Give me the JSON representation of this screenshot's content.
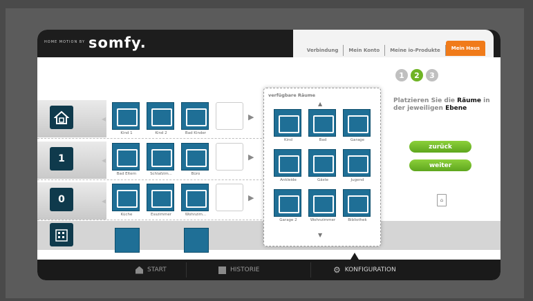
{
  "brand": {
    "tagline": "HOME MOTION BY",
    "logo": "somfy."
  },
  "tabs": [
    {
      "label": "Verbindung",
      "active": false
    },
    {
      "label": "Mein Konto",
      "active": false
    },
    {
      "label": "Meine io-Produkte",
      "active": false
    },
    {
      "label": "Mein Haus",
      "active": true
    }
  ],
  "levels": [
    {
      "name": "top-level",
      "icon": "house-roof-icon",
      "number": "",
      "rooms": [
        {
          "label": "Kind 1"
        },
        {
          "label": "Kind 2"
        },
        {
          "label": "Bad Kinder"
        }
      ]
    },
    {
      "name": "level-1",
      "icon": "house-level-1-icon",
      "number": "1",
      "rooms": [
        {
          "label": "Bad Eltern"
        },
        {
          "label": "Schlafzim..."
        },
        {
          "label": "Büro"
        }
      ]
    },
    {
      "name": "level-0",
      "icon": "house-level-0-icon",
      "number": "0",
      "rooms": [
        {
          "label": "Küche"
        },
        {
          "label": "Esszimmer"
        },
        {
          "label": "Wohnzim..."
        }
      ]
    }
  ],
  "available_rooms": {
    "title": "verfügbare Räume",
    "rooms": [
      {
        "label": "Kind"
      },
      {
        "label": "Bad"
      },
      {
        "label": "Garage"
      },
      {
        "label": "Ankleide"
      },
      {
        "label": "Gäste"
      },
      {
        "label": "Jugend"
      },
      {
        "label": "Garage 2"
      },
      {
        "label": "Wohnzimmer"
      },
      {
        "label": "Bibliothek"
      }
    ]
  },
  "steps": [
    "1",
    "2",
    "3"
  ],
  "active_step": "2",
  "instruction": {
    "prefix": "Platzieren Sie die ",
    "bold1": "Räume",
    "middle": " in der jeweiligen ",
    "bold2": "Ebene"
  },
  "buttons": {
    "back": "zurück",
    "next": "weiter"
  },
  "navigation": [
    {
      "label": "START",
      "icon": "house-icon",
      "active": false
    },
    {
      "label": "HISTORIE",
      "icon": "history-icon",
      "active": false
    },
    {
      "label": "KONFIGURATION",
      "icon": "gear-icon",
      "active": true
    }
  ],
  "colors": {
    "accent": "#f07b1a",
    "confirm": "#6fb425",
    "tile": "#1f6f96",
    "level_icon": "#0f3a4c"
  }
}
